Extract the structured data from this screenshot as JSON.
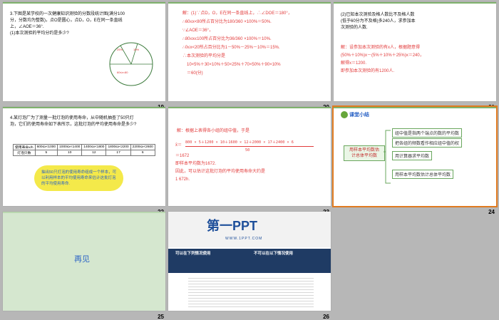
{
  "slides": [
    {
      "num": "19",
      "lines": [
        "3.下图是某学校的一次健康知识测验的分数段统计图(满分100",
        "分，分数均为整数)，点O是圆心，点D，O，E在同一条直线",
        "上，∠AOE＝36°.",
        "(1)本次测验的平均分约是多少?"
      ],
      "pie": {
        "labels": [
          "60≤x<80",
          "80≤x≤100",
          "60分以下"
        ],
        "pct": [
          "25%",
          "10%"
        ]
      }
    },
    {
      "num": "20",
      "lines": [
        "解：(1)∵点D，O，E在同一条直线上，∴∠DOE＝180°，",
        "∴60≤x<80所占百分比为180/360 ×100%＝50%.",
        "∵∠AOE＝36°，",
        "∴80≤x≤100所占百分比为36/360 ×100%＝10%.",
        "∴0≤x<20所占百分比为1－50%－25%－10%＝15%.",
        "∴本次测验的平均分是",
        "10×5%＋30×10%＋50×25%＋70×50%＋90×10%",
        "＝60(分)"
      ]
    },
    {
      "num": "21",
      "lines": [
        "(2)已知本次测验及格人数比不及格人数",
        "(低于60分为不及格)多240人，求参加本",
        "次测验的人数."
      ],
      "ans": [
        "解：设参加本次测验的有x人，根据题意得",
        "(50%＋10%)x－(5%＋10%＋25%)x＝240，",
        "解得x＝1200.",
        "即参加本次测验的有1200人."
      ]
    },
    {
      "num": "22",
      "lines": [
        "4.某灯泡厂为了测量一批灯泡的使用寿命，从中随机抽查了50只灯",
        "泡，它们的使用寿命如下表所示，这批灯泡的平均使用寿命是多少?"
      ],
      "table": {
        "r1": [
          "使用寿命x/h",
          "600≤x<1000",
          "1000≤x<1400",
          "1400≤x<1800",
          "1800≤x<2200",
          "2200≤x<2600"
        ],
        "r2": [
          "灯泡只数",
          "5",
          "10",
          "12",
          "17",
          "6"
        ]
      },
      "bubble": [
        "抽出50只灯泡的使用寿命组成一个样本，可",
        "以利用样本的平均使用寿命来估计这批灯泡",
        "的平均使用寿命."
      ]
    },
    {
      "num": "23",
      "lines": [
        "解：根据上表得各小组的组中值，于是",
        "800 × 5＋1200 × 10＋1600 × 12＋2000 × 17＋2400 × 6",
        "x̄＝",
        "50",
        "＝1672",
        "即样本平均数为1672.",
        "因此，可以估计这批灯泡的平均使用寿命大约是",
        "1 672h."
      ]
    },
    {
      "num": "24",
      "title": "课堂小结",
      "center": [
        "用样本平均数估",
        "计总体平均数"
      ],
      "items": [
        "组中值是指两个端点的数的平均数",
        "把各组的频数看作相应组中值的权",
        "用计算器求平均数",
        "用样本平均数估计总体平均数"
      ]
    },
    {
      "num": "25",
      "text": "再见"
    },
    {
      "num": "26",
      "brand": "第一PPT",
      "url": "WWW.1PPT.COM",
      "left_title": "可以在下列情况使用",
      "right_title": "不可以在以下情况使用"
    }
  ]
}
